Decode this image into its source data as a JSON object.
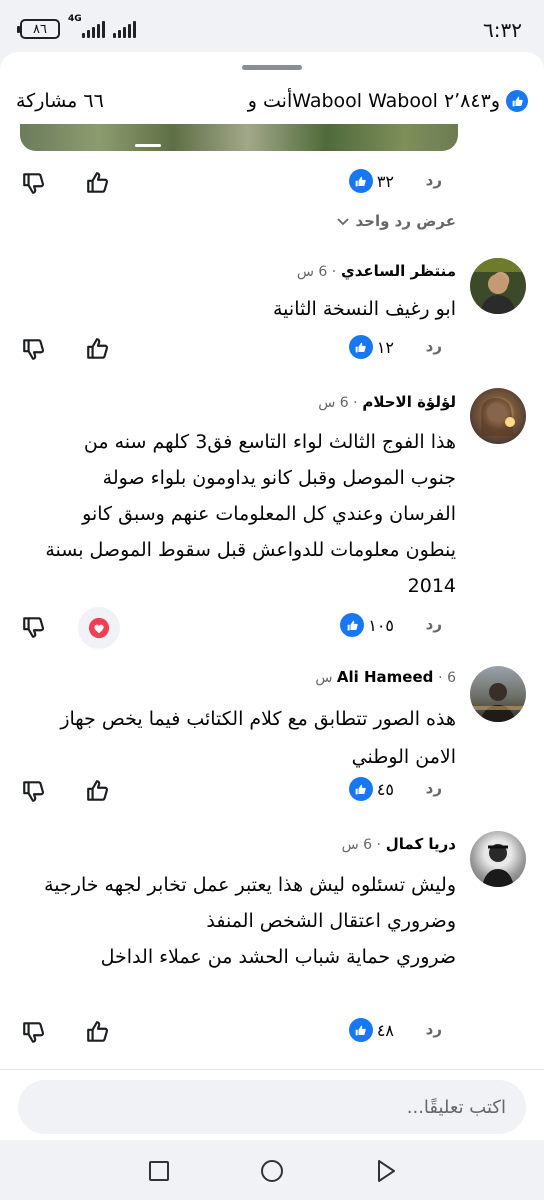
{
  "status_bar": {
    "time": "٦:٣٢",
    "battery": "٨٦",
    "network": "4G"
  },
  "header": {
    "reactors_text": "أنت وWabool Wabool و٢٬٨٤٣",
    "share_count": "٦٦ مشاركة"
  },
  "first_comment_actions": {
    "reply": "رد",
    "like_count": "٣٢",
    "view_replies": "عرض رد واحد"
  },
  "comments": [
    {
      "author": "منتظر الساعدي",
      "time": "6 س",
      "text": "ابو رغيف النسخة الثانية",
      "reply": "رد",
      "like_count": "١٢"
    },
    {
      "author": "لؤلؤة الاحلام",
      "time": "6 س",
      "text": "هذا الفوج الثالث لواء التاسع فق3 كلهم سنه من جنوب الموصل وقبل كانو يداومون بلواء صولة الفرسان وعندي كل المعلومات عنهم وسبق كانو ينطون معلومات للدواعش قبل سقوط الموصل بسنة 2014",
      "reply": "رد",
      "like_count": "١٠٥"
    },
    {
      "author": "Ali Hameed",
      "time": "6 س",
      "text": "هذه الصور تتطابق مع كلام الكتائب فيما يخص جهاز الامن الوطني",
      "reply": "رد",
      "like_count": "٤٥"
    },
    {
      "author": "دريا كمال",
      "time": "6 س",
      "text_lines": [
        "وليش تسئلوه ليش هذا يعتبر عمل تخابر لجهه خارجية",
        "وضروري اعتقال الشخص المنفذ",
        "ضروري حماية شباب الحشد من عملاء الداخل"
      ],
      "reply": "رد",
      "like_count": "٤٨"
    }
  ],
  "composer": {
    "placeholder": "اكتب تعليقًا..."
  },
  "colors": {
    "facebook_blue": "#1877f2",
    "secondary_text": "#65676b",
    "heart_red": "#f33e58"
  }
}
